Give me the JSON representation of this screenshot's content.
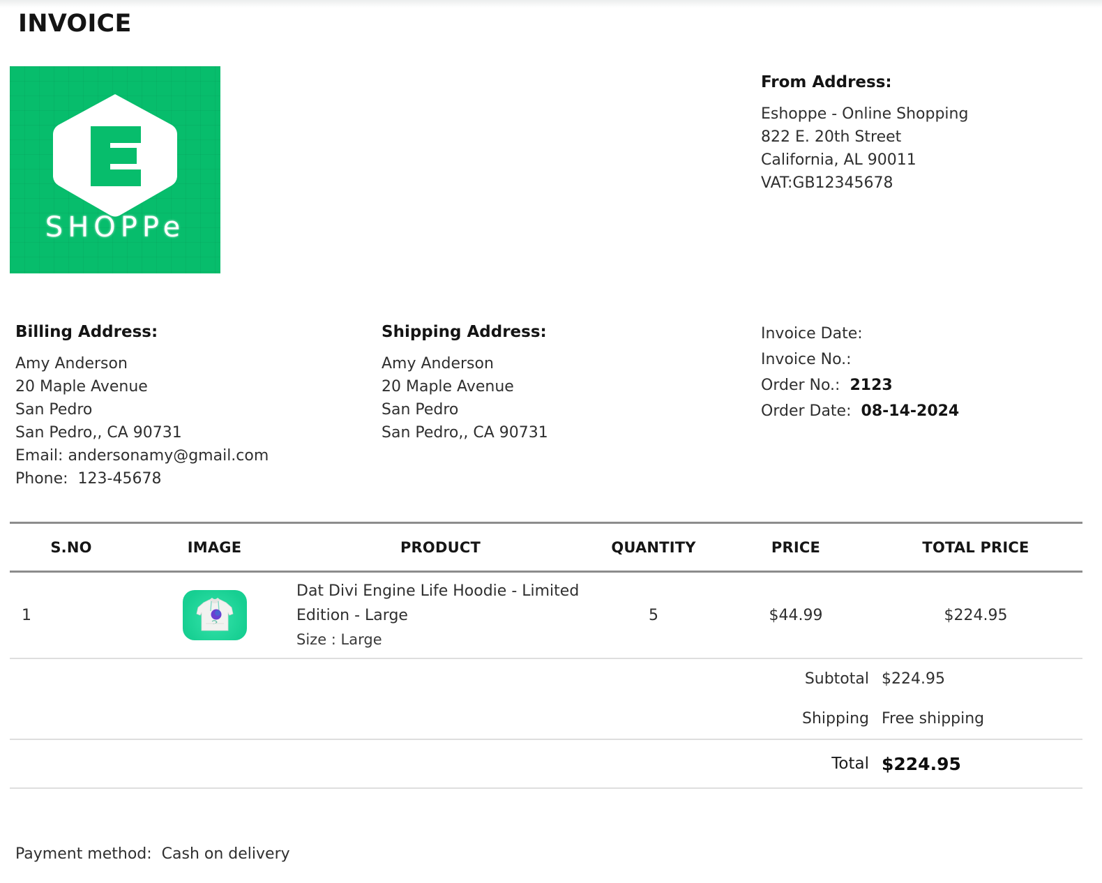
{
  "document": {
    "title": "INVOICE"
  },
  "logo": {
    "mark_letter": "E",
    "wordmark_upper": "SHOPP",
    "wordmark_tail": "e",
    "background_color": "#07bd6c"
  },
  "from": {
    "heading": "From Address:",
    "lines": [
      "Eshoppe - Online Shopping",
      "822 E. 20th Street",
      "California, AL 90011",
      "VAT:GB12345678"
    ]
  },
  "billing": {
    "heading": "Billing Address:",
    "lines": [
      "Amy Anderson",
      "20 Maple Avenue",
      "San Pedro",
      "San Pedro,, CA 90731",
      "Email: andersonamy@gmail.com",
      "Phone:  123-45678"
    ]
  },
  "shipping": {
    "heading": "Shipping Address:",
    "lines": [
      "Amy Anderson",
      "20 Maple Avenue",
      "San Pedro",
      "San Pedro,, CA 90731"
    ]
  },
  "meta": {
    "invoice_date_label": "Invoice Date:",
    "invoice_date_value": "",
    "invoice_no_label": "Invoice No.:",
    "invoice_no_value": "",
    "order_no_label": "Order No.:",
    "order_no_value": "2123",
    "order_date_label": "Order Date:",
    "order_date_value": "08-14-2024"
  },
  "table": {
    "headers": {
      "sno": "S.NO",
      "image": "IMAGE",
      "product": "PRODUCT",
      "quantity": "QUANTITY",
      "price": "PRICE",
      "total_price": "TOTAL PRICE"
    },
    "rows": [
      {
        "sno": "1",
        "image_alt": "product-thumbnail-hoodie",
        "product_name": "Dat Divi Engine Life Hoodie - Limited Edition - Large",
        "product_size": "Size : Large",
        "quantity": "5",
        "price": "$44.99",
        "total_price": "$224.95"
      }
    ]
  },
  "totals": {
    "subtotal_label": "Subtotal",
    "subtotal_value": "$224.95",
    "shipping_label": "Shipping",
    "shipping_value": "Free shipping",
    "total_label": "Total",
    "total_value": "$224.95"
  },
  "footer": {
    "payment_method": "Payment method:  Cash on delivery"
  }
}
